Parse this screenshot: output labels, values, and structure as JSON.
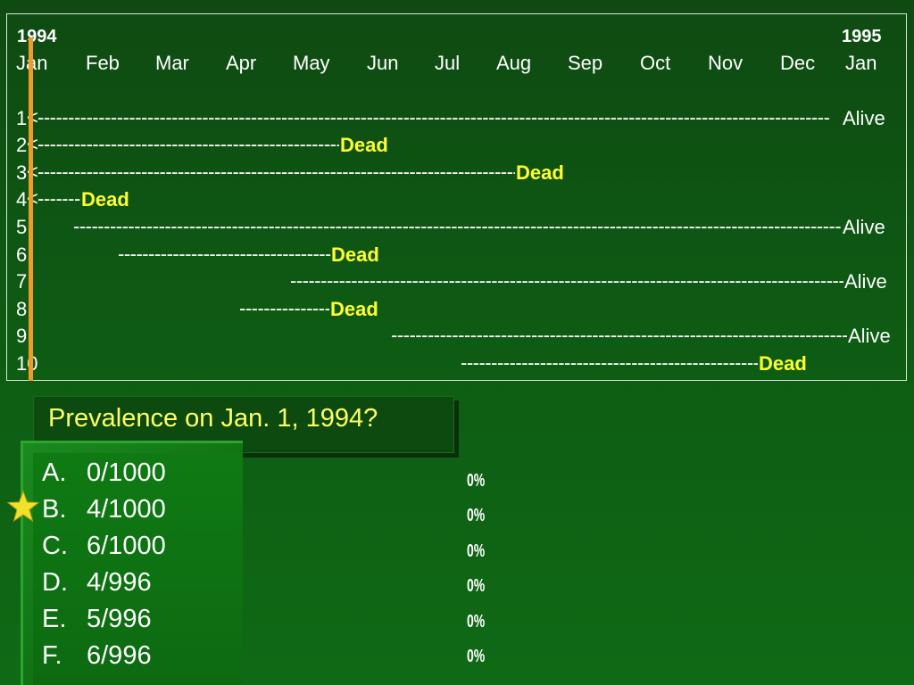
{
  "timeline": {
    "year_start": "1994",
    "year_end": "1995",
    "months": [
      "Jan",
      "Feb",
      "Mar",
      "Apr",
      "May",
      "Jun",
      "Jul",
      "Aug",
      "Sep",
      "Oct",
      "Nov",
      "Dec",
      "Jan"
    ],
    "rows": [
      {
        "label": "1",
        "arrow": "<",
        "status": "Alive"
      },
      {
        "label": "2",
        "arrow": "<",
        "status": "Dead"
      },
      {
        "label": "3",
        "arrow": "<",
        "status": "Dead"
      },
      {
        "label": "4",
        "arrow": "<",
        "status": "Dead"
      },
      {
        "label": "5",
        "arrow": "",
        "status": "Alive"
      },
      {
        "label": "6",
        "arrow": "",
        "status": "Dead"
      },
      {
        "label": "7",
        "arrow": "",
        "status": "Alive"
      },
      {
        "label": "8",
        "arrow": "",
        "status": "Dead"
      },
      {
        "label": "9",
        "arrow": "",
        "status": "Alive"
      },
      {
        "label": "10",
        "arrow": "",
        "status": "Dead"
      }
    ]
  },
  "question": "Prevalence on Jan. 1, 1994?",
  "options": [
    {
      "letter": "A.",
      "text": "0/1000",
      "percent": "0%"
    },
    {
      "letter": "B.",
      "text": "4/1000",
      "percent": "0%"
    },
    {
      "letter": "C.",
      "text": "6/1000",
      "percent": "0%"
    },
    {
      "letter": "D.",
      "text": "4/996",
      "percent": "0%"
    },
    {
      "letter": "E.",
      "text": "5/996",
      "percent": "0%"
    },
    {
      "letter": "F.",
      "text": "6/996",
      "percent": "0%"
    }
  ],
  "correct_option_icon": "star-icon",
  "colors": {
    "dead": "#ffff33",
    "question": "#ffff66",
    "start_line": "#f09a2a"
  }
}
